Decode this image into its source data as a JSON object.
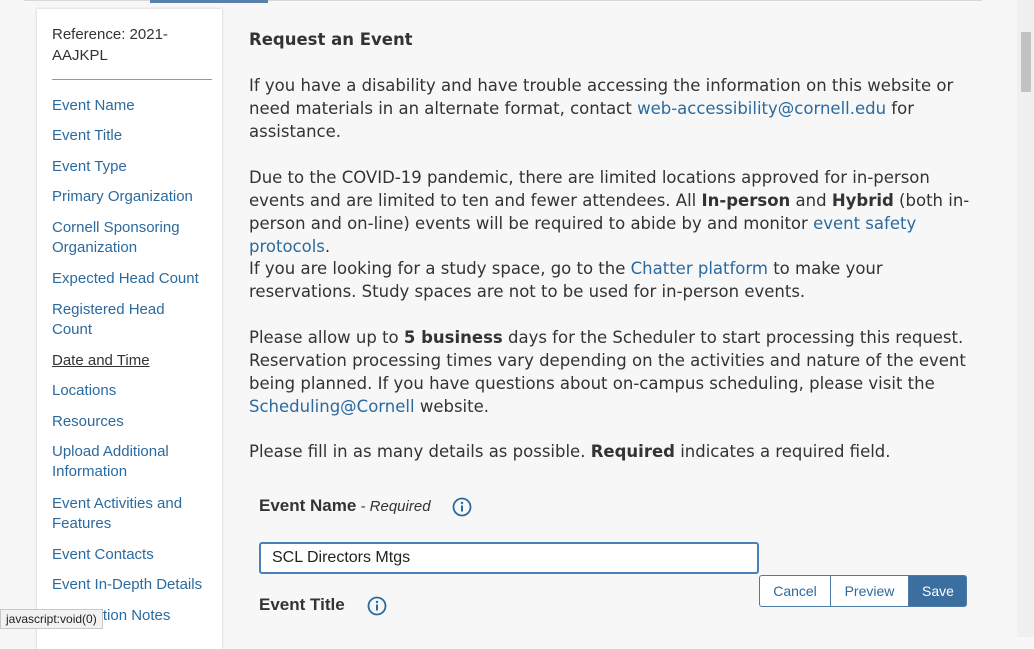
{
  "sidebar": {
    "reference": "Reference: 2021-AAJKPL",
    "items": [
      {
        "label": "Event Name"
      },
      {
        "label": "Event Title"
      },
      {
        "label": "Event Type"
      },
      {
        "label": "Primary Organization"
      },
      {
        "label": "Cornell Sponsoring Organization"
      },
      {
        "label": "Expected Head Count"
      },
      {
        "label": "Registered Head Count"
      },
      {
        "label": "Date and Time"
      },
      {
        "label": "Locations"
      },
      {
        "label": "Resources"
      },
      {
        "label": "Upload Additional Information"
      },
      {
        "label": "Event Activities and Features"
      },
      {
        "label": "Event Contacts"
      },
      {
        "label": "Event In-Depth Details"
      },
      {
        "label": "Information Notes"
      }
    ]
  },
  "status_bar": {
    "text": "javascript:void(0)"
  },
  "main": {
    "heading": "Request an Event",
    "p1": {
      "before": "If you have a disability and have trouble accessing the information on this website or need materials in an alternate format, contact ",
      "link": "web-accessibility@cornell.edu",
      "after": " for assistance."
    },
    "p2": {
      "t1": "Due to the COVID-19 pandemic, there are limited locations approved for in-person events and are limited to ten and fewer attendees. All ",
      "b1": "In-person",
      "t2": " and ",
      "b2": "Hybrid",
      "t3": " (both in-person and on-line) events will be required to abide by and monitor ",
      "link": "event safety protocols",
      "t4": "."
    },
    "p3": {
      "before": "If you are looking for a study space, go to the ",
      "link": "Chatter platform",
      "after": " to make your reservations. Study spaces are not to be used for in-person events."
    },
    "p4": {
      "t1": "Please allow up to ",
      "b1": "5 business",
      "t2": " days for the Scheduler to start processing this request. Reservation processing times vary depending on the activities and nature of the event being planned. If you have questions about on-campus scheduling, please visit the ",
      "link": "Scheduling@Cornell",
      "t3": " website."
    },
    "p5": {
      "t1": "Please fill in as many details as possible. ",
      "b1": "Required",
      "t2": " indicates a required field."
    }
  },
  "form": {
    "event_name_label": "Event Name",
    "required_note": " - Required",
    "event_name_value": "SCL Directors Mtgs",
    "event_title_label": "Event Title"
  },
  "actions": {
    "cancel": "Cancel",
    "preview": "Preview",
    "save": "Save"
  },
  "colors": {
    "link": "#2b6a9f",
    "primary_button": "#3a6f9f"
  }
}
